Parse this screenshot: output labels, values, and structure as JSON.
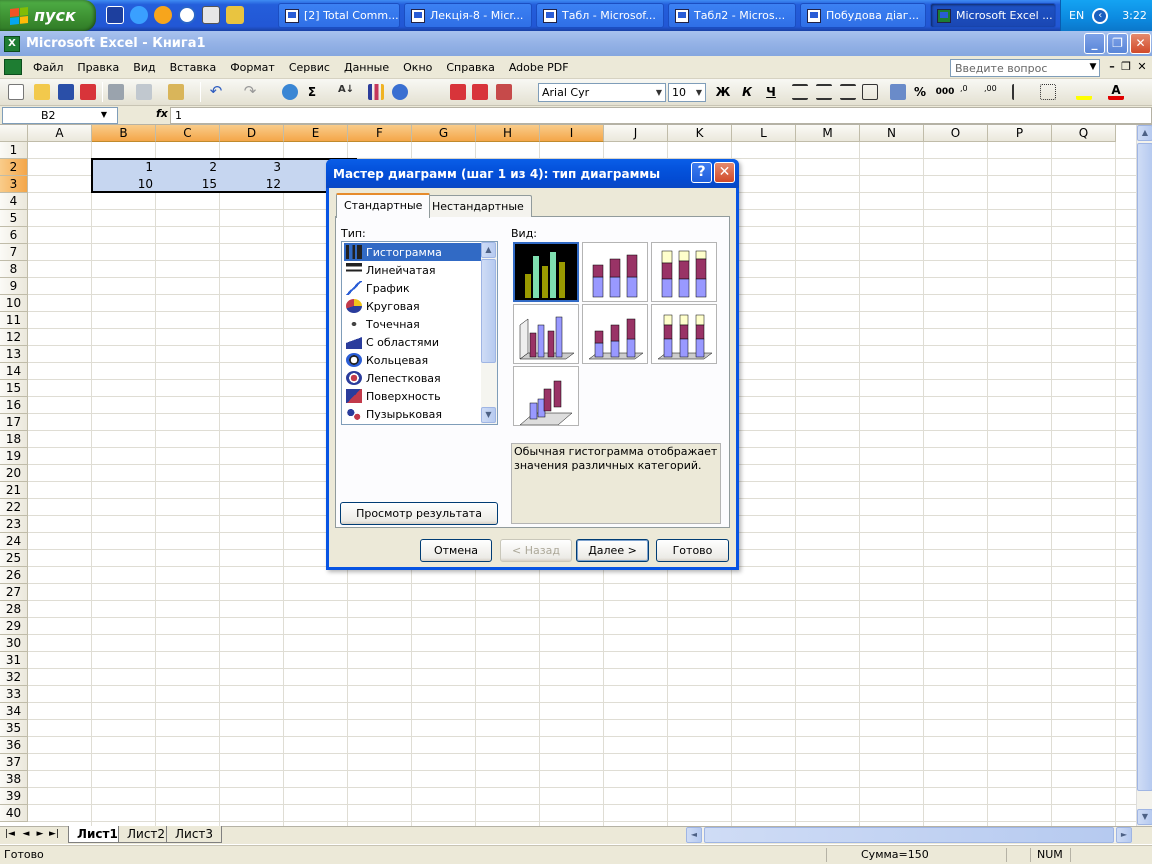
{
  "taskbar": {
    "start_label": "пуск",
    "buttons": [
      {
        "label": "[2] Total Comm..."
      },
      {
        "label": "Лекція-8 - Micr..."
      },
      {
        "label": "Табл - Microsof..."
      },
      {
        "label": "Табл2 - Micros..."
      },
      {
        "label": "Побудова діаг..."
      },
      {
        "label": "Microsoft Excel ..."
      }
    ],
    "lang": "EN",
    "clock": "3:22"
  },
  "window": {
    "title": "Microsoft Excel - Книга1"
  },
  "menu": {
    "items": [
      "Файл",
      "Правка",
      "Вид",
      "Вставка",
      "Формат",
      "Сервис",
      "Данные",
      "Окно",
      "Справка",
      "Adobe PDF"
    ],
    "ask_placeholder": "Введите вопрос"
  },
  "toolbar": {
    "font": "Arial Cyr",
    "size": "10",
    "bold": "Ж",
    "italic": "К",
    "underline": "Ч",
    "percent": "%",
    "thousands": "000",
    "sigma": "Σ"
  },
  "formula": {
    "cell": "B2",
    "fx": "fx",
    "value": "1"
  },
  "grid": {
    "columns": [
      "A",
      "B",
      "C",
      "D",
      "E",
      "F",
      "G",
      "H",
      "I",
      "J",
      "K",
      "L",
      "M",
      "N",
      "O",
      "P",
      "Q"
    ],
    "selected_cols": [
      "B",
      "C",
      "D",
      "E",
      "F",
      "G",
      "H",
      "I"
    ],
    "rows": [
      "1",
      "2",
      "3",
      "4",
      "5",
      "6",
      "7",
      "8",
      "9",
      "10",
      "11",
      "12",
      "13",
      "14",
      "15",
      "16",
      "17",
      "18",
      "19",
      "20",
      "21",
      "22",
      "23",
      "24",
      "25",
      "26",
      "27",
      "28",
      "29",
      "30",
      "31",
      "32",
      "33",
      "34",
      "35",
      "36",
      "37",
      "38",
      "39",
      "40"
    ],
    "selected_rows": [
      "2",
      "3"
    ],
    "row2": [
      "1",
      "2",
      "3"
    ],
    "row3": [
      "10",
      "15",
      "12"
    ]
  },
  "sheets": [
    "Лист1",
    "Лист2",
    "Лист3"
  ],
  "status": {
    "ready": "Готово",
    "sum": "Сумма=150",
    "num": "NUM"
  },
  "dialog": {
    "title": "Мастер диаграмм (шаг 1 из 4): тип диаграммы",
    "tabs": [
      "Стандартные",
      "Нестандартные"
    ],
    "type_label": "Тип:",
    "view_label": "Вид:",
    "types": [
      "Гистограмма",
      "Линейчатая",
      "График",
      "Круговая",
      "Точечная",
      "С областями",
      "Кольцевая",
      "Лепестковая",
      "Поверхность",
      "Пузырьковая"
    ],
    "description": "Обычная гистограмма отображает значения различных категорий.",
    "preview_button": "Просмотр результата",
    "buttons": {
      "cancel": "Отмена",
      "back": "< Назад",
      "next": "Далее >",
      "finish": "Готово"
    }
  },
  "colors": {
    "title_blue": "#0554de",
    "selection": "#c6d6f0",
    "header_sel": "#f4a649"
  }
}
